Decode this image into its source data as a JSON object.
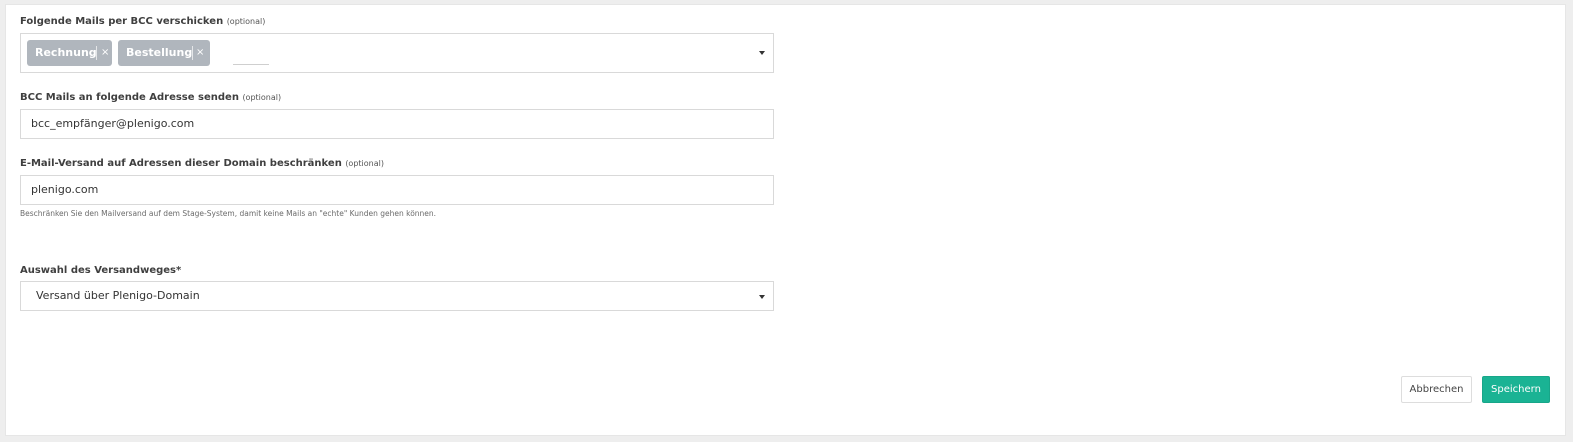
{
  "form": {
    "bcc_types": {
      "label": "Folgende Mails per BCC verschicken",
      "optional": "(optional)",
      "tags": [
        {
          "label": "Rechnung",
          "remove": "×"
        },
        {
          "label": "Bestellung",
          "remove": "×"
        }
      ]
    },
    "bcc_address": {
      "label": "BCC Mails an folgende Adresse senden",
      "optional": "(optional)",
      "value": "bcc_empfänger@plenigo.com"
    },
    "domain_restriction": {
      "label": "E-Mail-Versand auf Adressen dieser Domain beschränken",
      "optional": "(optional)",
      "value": "plenigo.com",
      "help": "Beschränken Sie den Mailversand auf dem Stage-System, damit keine Mails an \"echte\" Kunden gehen können."
    },
    "shipping_method": {
      "label": "Auswahl des Versandweges*",
      "selected": "Versand über Plenigo-Domain"
    }
  },
  "actions": {
    "cancel_label": "Abbrechen",
    "save_label": "Speichern"
  },
  "colors": {
    "primary": "#1ab394",
    "tag_bg": "#b0b6bd",
    "page_bg": "#eeeeee"
  },
  "icons": {
    "dropdown": "caret-down-icon",
    "tag_remove": "close-icon"
  }
}
